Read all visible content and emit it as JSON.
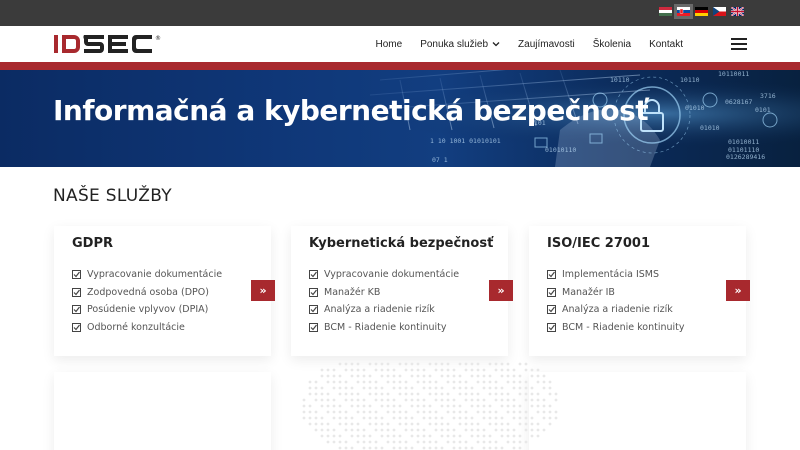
{
  "languages": [
    "hu",
    "sk",
    "de",
    "cz",
    "en"
  ],
  "selected_language": "sk",
  "brand": {
    "logo_text": "IDSEC",
    "registered_mark": "®",
    "accent": "#a8292e"
  },
  "nav": {
    "items": [
      "Home",
      "Ponuka služieb",
      "Zaujímavosti",
      "Školenia",
      "Kontakt"
    ]
  },
  "hero": {
    "title": "Informačná a kybernetická bezpečnosť",
    "code_fragments": [
      "10110011",
      "0628167",
      "1 10 1001 0101",
      "0101",
      "01010110",
      "01010",
      "07 1",
      "0101",
      "10110",
      "10110",
      "01010",
      "3716",
      "01101110",
      "01010011",
      "0126289416",
      "0101"
    ]
  },
  "services": {
    "title": "NAŠE SLUŽBY",
    "cards": [
      {
        "title": "GDPR",
        "items": [
          "Vypracovanie dokumentácie",
          "Zodpovedná osoba (DPO)",
          "Posúdenie vplyvov (DPIA)",
          "Odborné konzultácie"
        ],
        "more": "»"
      },
      {
        "title": "Kybernetická bezpečnosť",
        "items": [
          "Vypracovanie dokumentácie",
          "Manažér KB",
          "Analýza a riadenie rizík",
          "BCM - Riadenie kontinuity"
        ],
        "more": "»"
      },
      {
        "title": "ISO/IEC 27001",
        "items": [
          "Implementácia ISMS",
          "Manažér IB",
          "Analýza a riadenie rizík",
          "BCM - Riadenie kontinuity"
        ],
        "more": "»"
      }
    ]
  }
}
